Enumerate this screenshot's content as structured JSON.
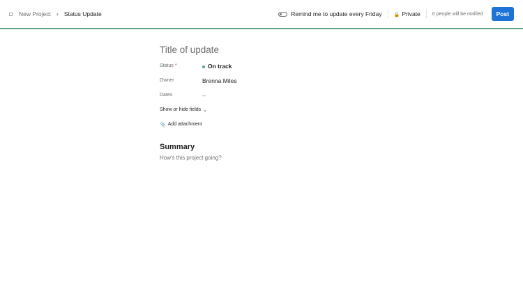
{
  "breadcrumb": {
    "project": "New Project",
    "current": "Status Update"
  },
  "header": {
    "remind_label": "Remind me to update every Friday",
    "privacy": "Private",
    "notify": "0 people will be notified",
    "post": "Post"
  },
  "form": {
    "title_placeholder": "Title of update",
    "fields": [
      {
        "label": "Status",
        "required": "*",
        "value": "On track"
      },
      {
        "label": "Owner",
        "value": "Brenna Miles"
      },
      {
        "label": "Dates",
        "value": "–"
      }
    ],
    "show_hide": "Show or hide fields",
    "attachment": "Add attachment",
    "summary_heading": "Summary",
    "summary_placeholder": "How's this project going?"
  },
  "colors": {
    "accent": "#5da283",
    "button": "#1f73d6"
  }
}
